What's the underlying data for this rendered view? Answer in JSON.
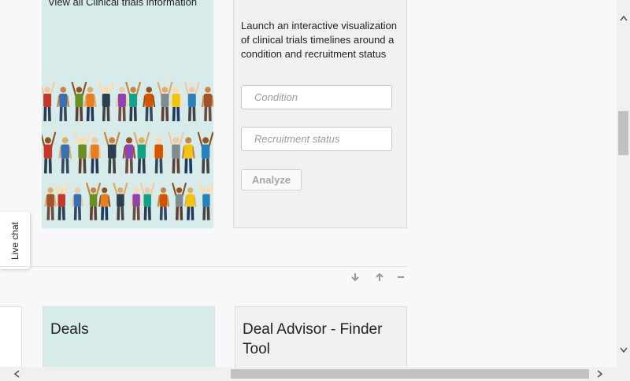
{
  "clinical_card": {
    "caption": "View all Clinical trials information"
  },
  "analyze_panel": {
    "description": "Launch an interactive visualization of clinical trials timelines around a condition and recruitment status",
    "condition_placeholder": "Condition",
    "recruitment_placeholder": "Recruitment status",
    "analyze_label": "Analyze"
  },
  "live_chat": {
    "label": "Live chat"
  },
  "section_controls": {
    "down_icon": "arrow-down-icon",
    "up_icon": "arrow-up-icon",
    "collapse_icon": "minus-icon"
  },
  "cards": {
    "deals_title": "Deals",
    "advisor_title": "Deal Advisor - Finder Tool"
  },
  "colors": {
    "teal_card": "#d8ebeb",
    "grey_card": "#f1f1f1",
    "page_bg": "#f8f7fa"
  }
}
